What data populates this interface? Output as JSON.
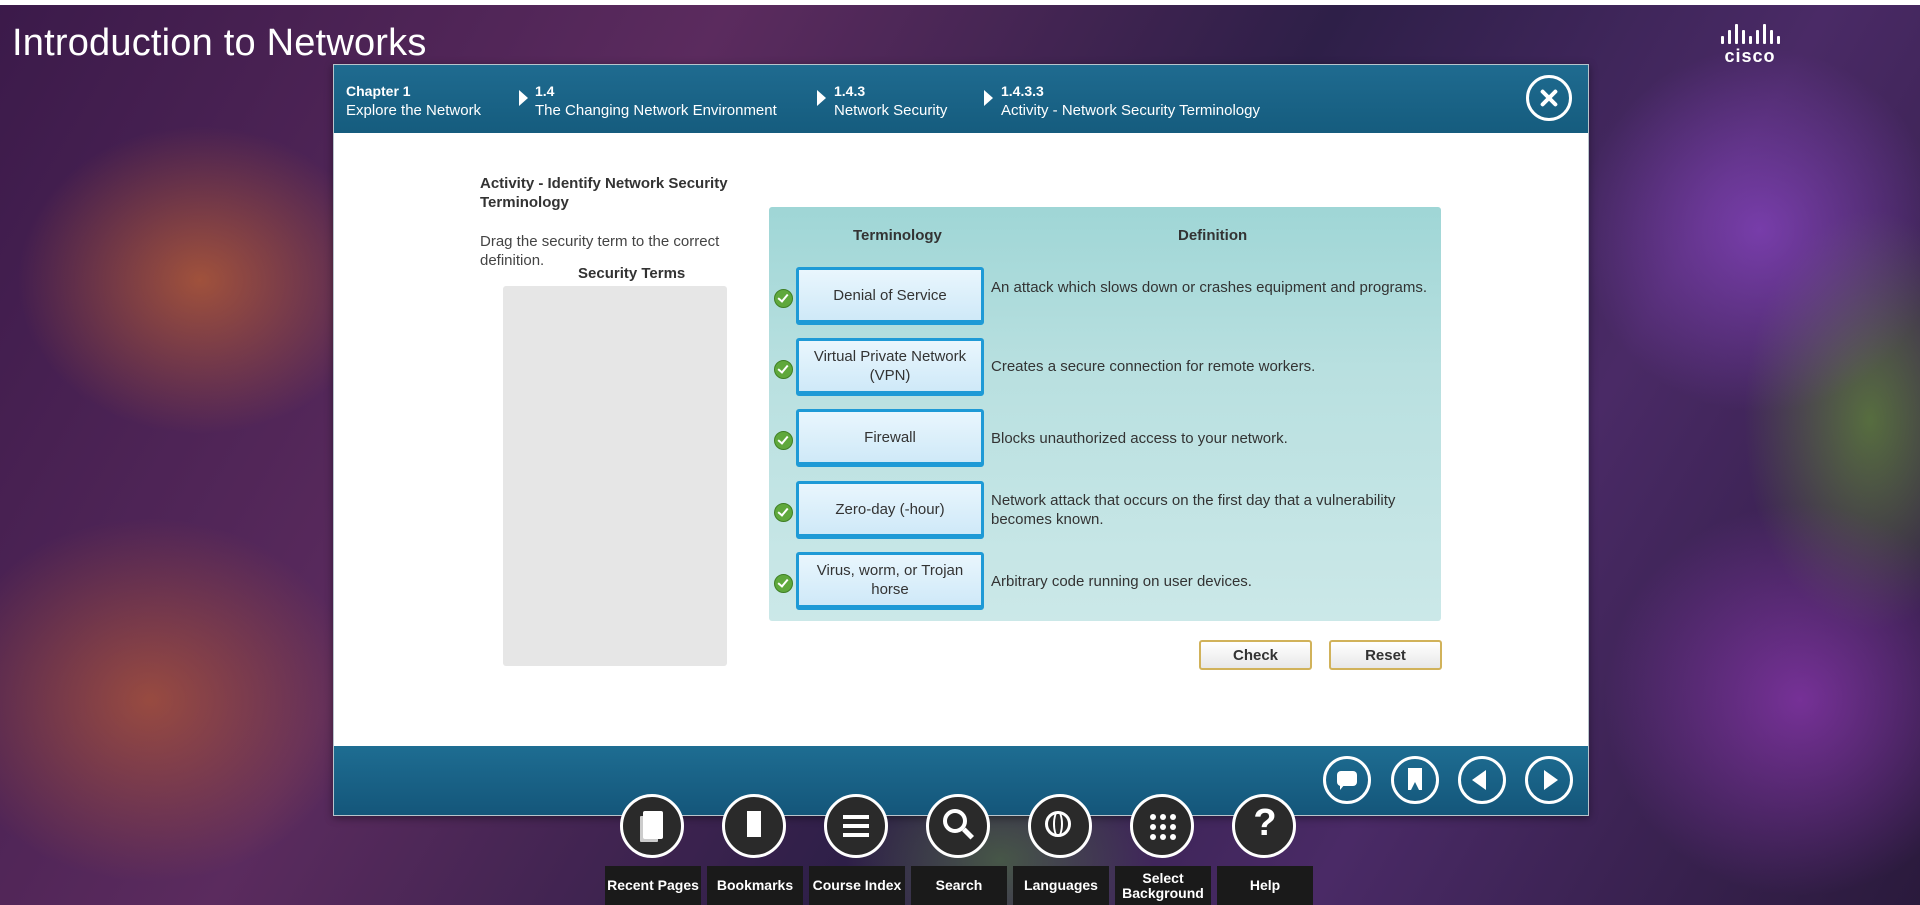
{
  "app": {
    "title": "Introduction to Networks",
    "logo_text": "cisco"
  },
  "breadcrumb": [
    {
      "num": "Chapter 1",
      "label": "Explore the Network"
    },
    {
      "num": "1.4",
      "label": "The Changing Network Environment"
    },
    {
      "num": "1.4.3",
      "label": "Network Security"
    },
    {
      "num": "1.4.3.3",
      "label": "Activity - Network Security Terminology"
    }
  ],
  "activity": {
    "title": "Activity - Identify Network Security Terminology",
    "instructions": "Drag the security term to the correct definition.",
    "terms_heading": "Security Terms",
    "columns": {
      "terminology": "Terminology",
      "definition": "Definition"
    },
    "rows": [
      {
        "term": "Denial of Service",
        "definition": "An attack which slows down or crashes equipment and programs.",
        "correct": true
      },
      {
        "term": "Virtual Private Network (VPN)",
        "definition": "Creates a secure connection for remote workers.",
        "correct": true
      },
      {
        "term": "Firewall",
        "definition": "Blocks unauthorized access to your network.",
        "correct": true
      },
      {
        "term": "Zero-day (-hour)",
        "definition": "Network attack that occurs on the first day that a vulnerability becomes known.",
        "correct": true
      },
      {
        "term": "Virus, worm, or Trojan horse",
        "definition": "Arbitrary code running on user devices.",
        "correct": true
      }
    ],
    "check_label": "Check",
    "reset_label": "Reset"
  },
  "toolbar": [
    {
      "label": "Recent Pages",
      "icon": "pages-icon"
    },
    {
      "label": "Bookmarks",
      "icon": "bookmark-icon"
    },
    {
      "label": "Course Index",
      "icon": "list-icon"
    },
    {
      "label": "Search",
      "icon": "search-icon"
    },
    {
      "label": "Languages",
      "icon": "globe-icon"
    },
    {
      "label": "Select Background",
      "icon": "grid-icon"
    },
    {
      "label": "Help",
      "icon": "help-icon"
    }
  ],
  "colors": {
    "header_blue": "#1f6b90",
    "term_border": "#1e9ad6",
    "check_green": "#5fa83c",
    "button_border": "#d1b25a"
  }
}
